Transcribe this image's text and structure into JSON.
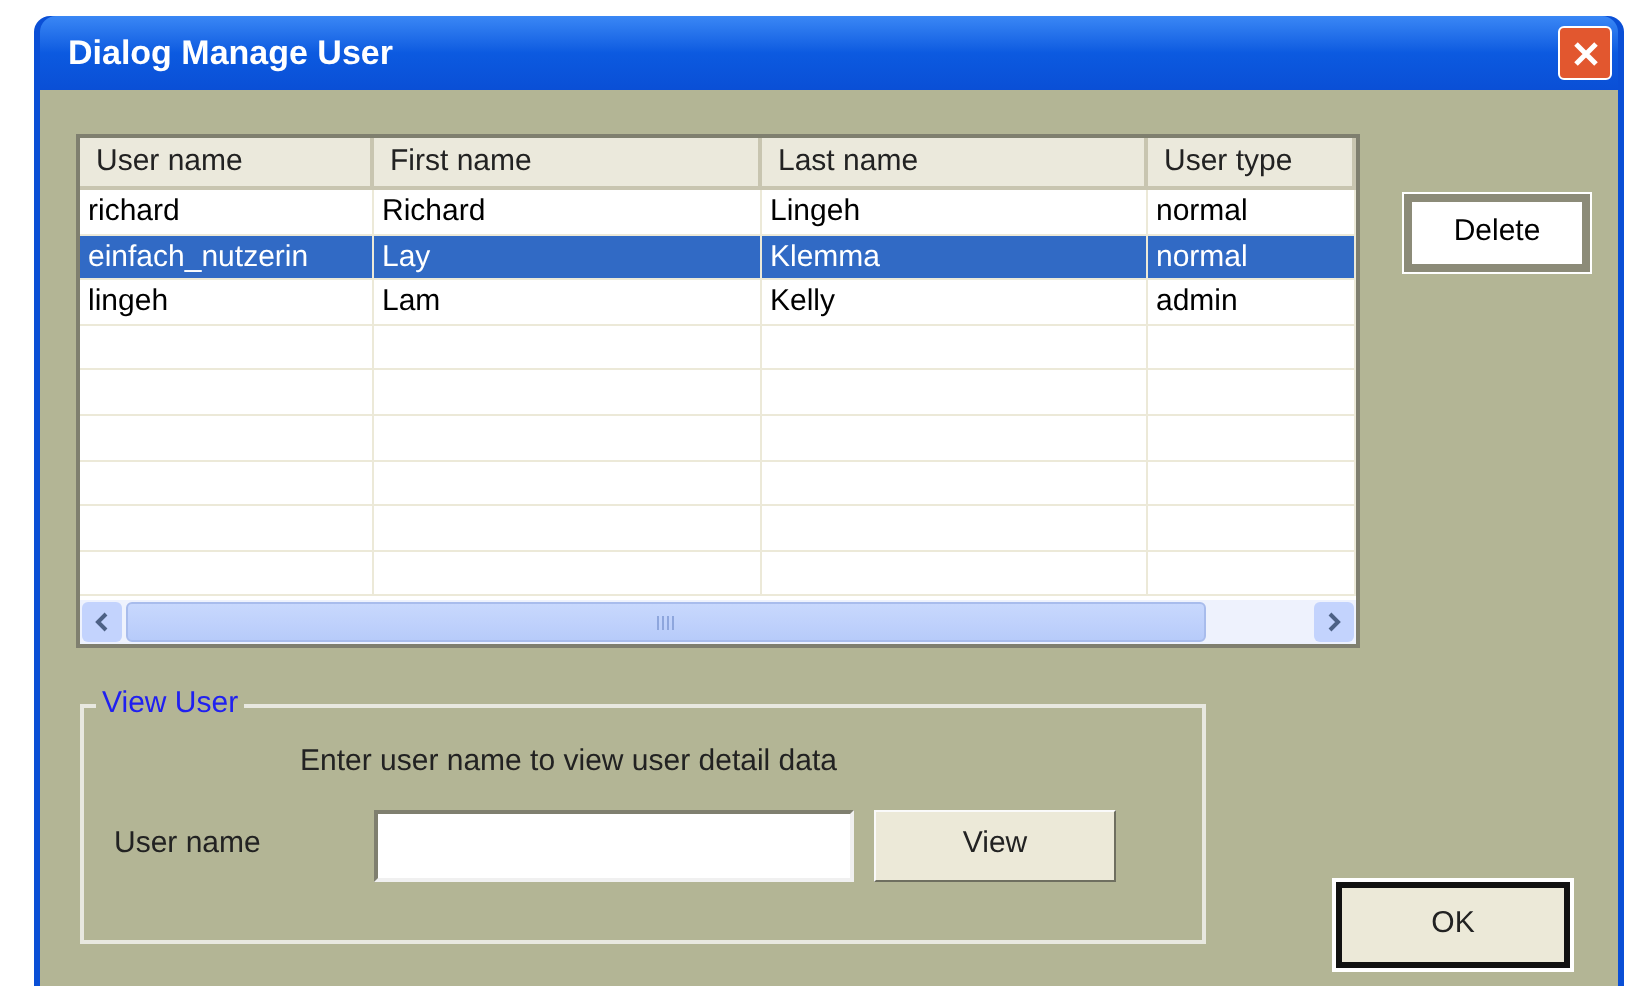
{
  "window": {
    "title": "Dialog Manage User"
  },
  "table": {
    "columns": [
      "User name",
      "First name",
      "Last name",
      "User type"
    ],
    "rows": [
      {
        "cells": [
          "richard",
          "Richard",
          "Lingeh",
          "normal"
        ],
        "selected": false
      },
      {
        "cells": [
          "einfach_nutzerin",
          "Lay",
          "Klemma",
          "normal"
        ],
        "selected": true
      },
      {
        "cells": [
          "lingeh",
          "Lam",
          "Kelly",
          "admin"
        ],
        "selected": false
      }
    ]
  },
  "delete_button": "Delete",
  "view_user": {
    "legend": "View User",
    "hint": "Enter user name to view user detail data",
    "label": "User name",
    "button": "View"
  },
  "ok_button": "OK"
}
